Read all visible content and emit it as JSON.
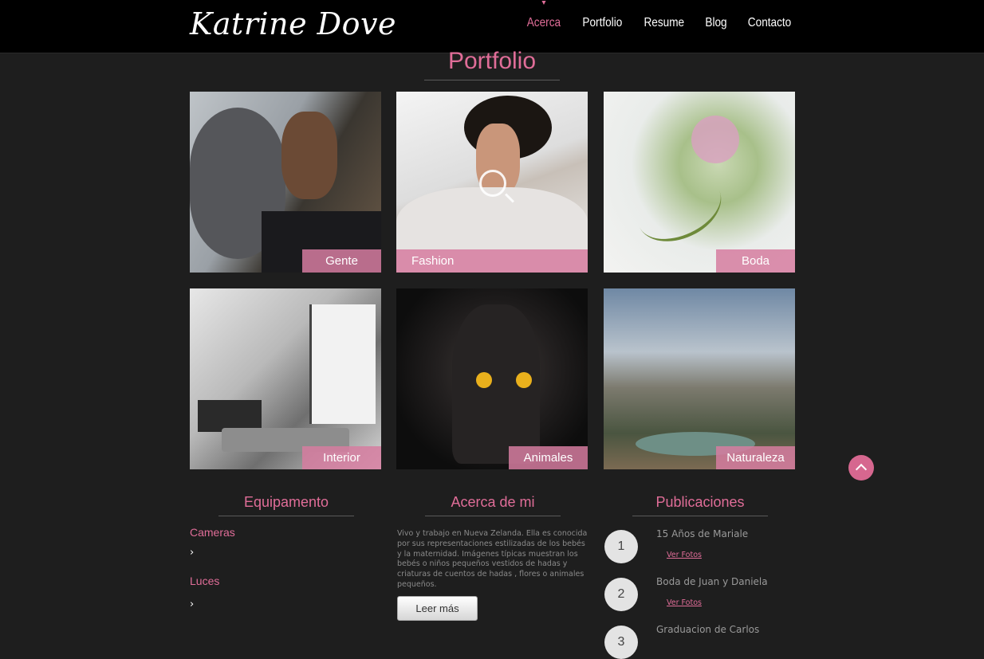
{
  "header": {
    "logo": "Katrine Dove",
    "nav": [
      "Acerca",
      "Portfolio",
      "Resume",
      "Blog",
      "Contacto"
    ],
    "active_nav": "Acerca"
  },
  "portfolio": {
    "title": "Portfolio",
    "tiles": [
      {
        "caption": "Gente"
      },
      {
        "caption": "Fashion"
      },
      {
        "caption": "Boda"
      },
      {
        "caption": "Interior"
      },
      {
        "caption": "Animales"
      },
      {
        "caption": "Naturaleza"
      }
    ]
  },
  "equipamento": {
    "title": "Equipamento",
    "items": [
      "Cameras",
      "Luces"
    ]
  },
  "about": {
    "title": "Acerca de mi",
    "text": "Vivo y trabajo en Nueva Zelanda. Ella es conocida por sus representaciones estilizadas de los bebés y la maternidad. Imágenes típicas muestran los bebés o niños pequeños vestidos de hadas y criaturas de cuentos de hadas , flores o animales pequeños.",
    "button": "Leer más"
  },
  "publicaciones": {
    "title": "Publicaciones",
    "items": [
      {
        "number": "1",
        "title": "15 Años de Mariale",
        "link": "Ver Fotos"
      },
      {
        "number": "2",
        "title": "Boda de Juan y Daniela",
        "link": "Ver Fotos"
      },
      {
        "number": "3",
        "title": "Graduacion de Carlos",
        "link": ""
      }
    ]
  },
  "colors": {
    "accent": "#e06d98",
    "background": "#1e1e1e",
    "header": "#000000"
  },
  "icons": {
    "scroll_top": "chevron-up-icon",
    "equip_chevron": "chevron-right-icon",
    "fashion_zoom": "magnifier-icon"
  }
}
